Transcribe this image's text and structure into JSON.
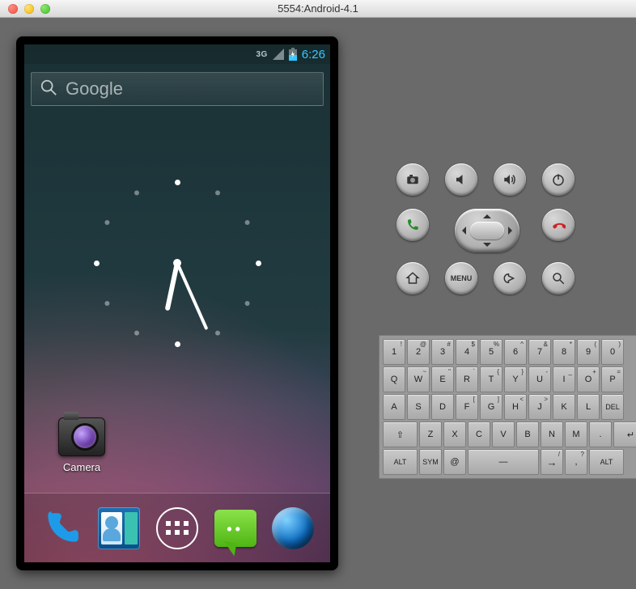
{
  "window": {
    "title": "5554:Android-4.1"
  },
  "statusbar": {
    "network": "3G",
    "time": "6:26"
  },
  "search": {
    "placeholder": "Google"
  },
  "desktop": {
    "camera_label": "Camera"
  },
  "hotseat": {
    "phone": "Phone",
    "contacts": "Contacts",
    "apps": "Apps",
    "messaging": "Messaging",
    "browser": "Browser"
  },
  "controls": {
    "row1": [
      "camera-icon",
      "volume-down-icon",
      "volume-up-icon",
      "power-icon"
    ],
    "call": "Call",
    "end": "End call",
    "home": "Home",
    "menu_label": "MENU",
    "back": "Back",
    "search": "Search"
  },
  "keyboard": {
    "row1": [
      {
        "m": "1",
        "s": "!"
      },
      {
        "m": "2",
        "s": "@"
      },
      {
        "m": "3",
        "s": "#"
      },
      {
        "m": "4",
        "s": "$"
      },
      {
        "m": "5",
        "s": "%"
      },
      {
        "m": "6",
        "s": "^"
      },
      {
        "m": "7",
        "s": "&"
      },
      {
        "m": "8",
        "s": "*"
      },
      {
        "m": "9",
        "s": "("
      },
      {
        "m": "0",
        "s": ")"
      }
    ],
    "row2": [
      {
        "m": "Q"
      },
      {
        "m": "W",
        "s": "~"
      },
      {
        "m": "E",
        "s": "\""
      },
      {
        "m": "R",
        "s": "`"
      },
      {
        "m": "T",
        "s": "{"
      },
      {
        "m": "Y",
        "s": "}"
      },
      {
        "m": "U",
        "s": "-"
      },
      {
        "m": "I",
        "s": "_"
      },
      {
        "m": "O",
        "s": "+"
      },
      {
        "m": "P",
        "s": "="
      }
    ],
    "row3": [
      {
        "m": "A"
      },
      {
        "m": "S"
      },
      {
        "m": "D"
      },
      {
        "m": "F",
        "s": "["
      },
      {
        "m": "G",
        "s": "]"
      },
      {
        "m": "H",
        "s": "<"
      },
      {
        "m": "J",
        "s": ">"
      },
      {
        "m": "K",
        ";": ";"
      },
      {
        "m": "L",
        ":": ":"
      },
      {
        "m": "DEL",
        "cls": "small"
      }
    ],
    "row4": [
      {
        "m": "⇧",
        "cls": "wide15"
      },
      {
        "m": "Z"
      },
      {
        "m": "X"
      },
      {
        "m": "C"
      },
      {
        "m": "V"
      },
      {
        "m": "B"
      },
      {
        "m": "N"
      },
      {
        "m": "M"
      },
      {
        "m": "."
      },
      {
        "m": "↵",
        "cls": "wide15"
      }
    ],
    "row5": [
      {
        "m": "ALT",
        "cls": "small wide15"
      },
      {
        "m": "SYM",
        "cls": "small"
      },
      {
        "m": "@"
      },
      {
        "m": "—",
        "cls": "space",
        "name": "space-key"
      },
      {
        "m": "→",
        "s": "/",
        "cls": "arrow"
      },
      {
        "m": ",",
        "s": "?"
      },
      {
        "m": "ALT",
        "cls": "small wide15"
      }
    ]
  }
}
